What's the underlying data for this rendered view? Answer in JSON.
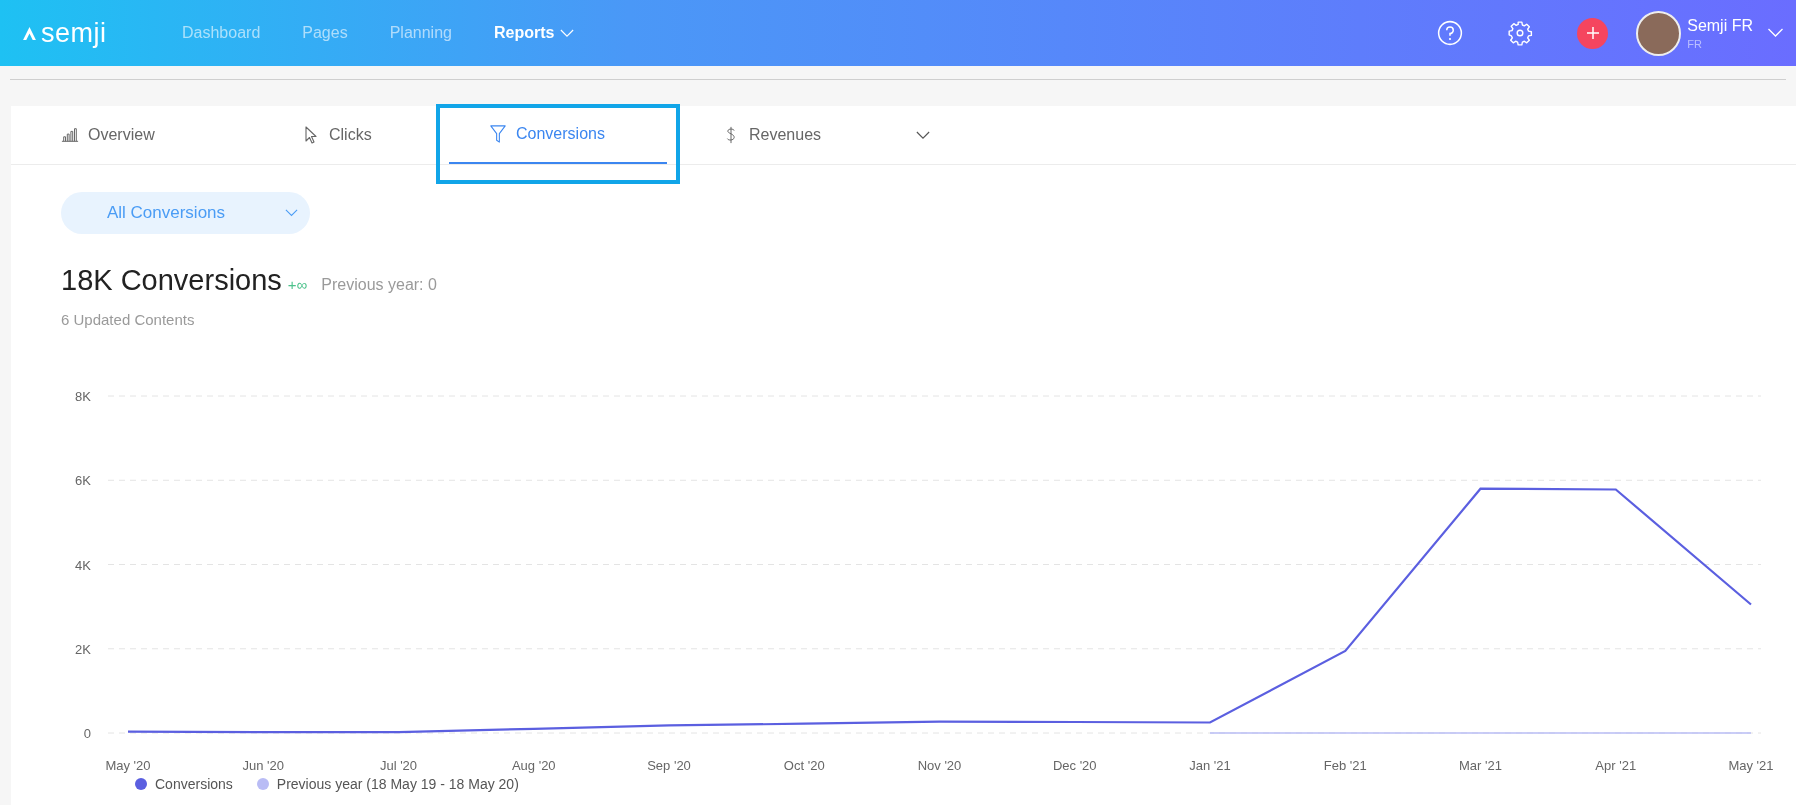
{
  "header": {
    "logo": "semji",
    "nav": [
      {
        "label": "Dashboard",
        "selected": false,
        "dropdown": false
      },
      {
        "label": "Pages",
        "selected": false,
        "dropdown": false
      },
      {
        "label": "Planning",
        "selected": false,
        "dropdown": false
      },
      {
        "label": "Reports",
        "selected": true,
        "dropdown": true
      }
    ],
    "user": {
      "name": "Semji FR",
      "locale": "FR"
    }
  },
  "tabs": [
    {
      "label": "Overview",
      "selected": false
    },
    {
      "label": "Clicks",
      "selected": false
    },
    {
      "label": "Conversions",
      "selected": true
    },
    {
      "label": "Revenues",
      "selected": false
    }
  ],
  "filter": {
    "value": "All Conversions"
  },
  "summary": {
    "title": "18K Conversions",
    "change": "+∞",
    "previous": "Previous year: 0",
    "subtitle": "6 Updated Contents"
  },
  "chart_data": {
    "type": "line",
    "grid": true,
    "legend": "bottom",
    "categories": [
      "May '20",
      "Jun '20",
      "Jul '20",
      "Aug '20",
      "Sep '20",
      "Oct '20",
      "Nov '20",
      "Dec '20",
      "Jan '21",
      "Feb '21",
      "Mar '21",
      "Apr '21",
      "May '21"
    ],
    "ylim": [
      0,
      8000
    ],
    "yticks": [
      {
        "value": 0,
        "label": "0"
      },
      {
        "value": 2000,
        "label": "2K"
      },
      {
        "value": 4000,
        "label": "4K"
      },
      {
        "value": 6000,
        "label": "6K"
      },
      {
        "value": 8000,
        "label": "8K"
      }
    ],
    "series": [
      {
        "name": "Conversions",
        "color": "#5b5fe0",
        "values": [
          30,
          20,
          20,
          100,
          180,
          220,
          270,
          260,
          250,
          1950,
          5800,
          5780,
          3050
        ]
      },
      {
        "name": "Previous year (18 May 19 - 18 May 20)",
        "color": "#b9bcf5",
        "values": [
          null,
          null,
          null,
          null,
          null,
          null,
          null,
          null,
          0,
          0,
          0,
          0,
          0
        ]
      }
    ]
  }
}
